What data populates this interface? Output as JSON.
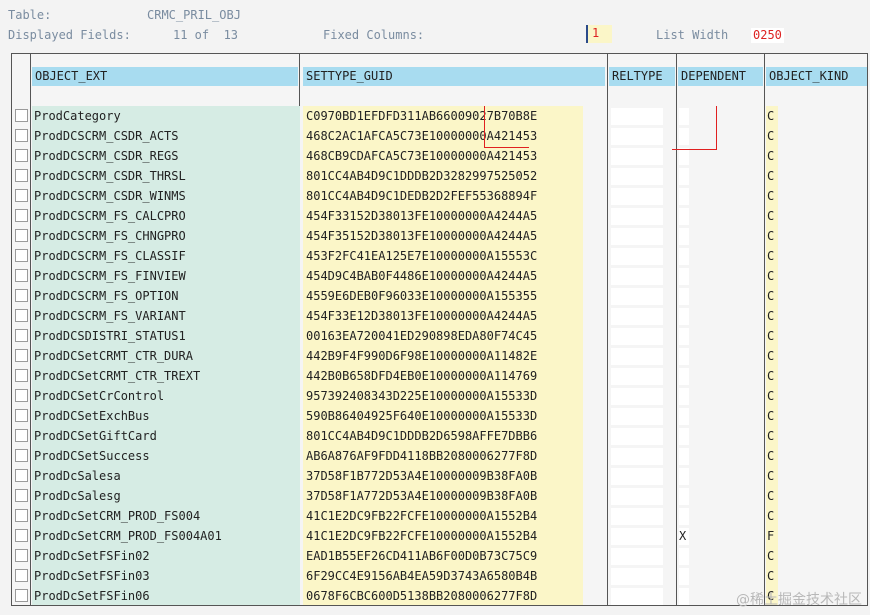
{
  "header": {
    "table_label": "Table:",
    "table_value": "CRMC_PRIL_OBJ",
    "displayed_label": "Displayed Fields:",
    "displayed_value": "11 of  13",
    "fixed_label": "Fixed Columns:",
    "fixed_value": "1",
    "list_width_label": "List Width",
    "list_width_value": "0250"
  },
  "columns": {
    "object_ext": "OBJECT_EXT",
    "settype_guid": "SETTYPE_GUID",
    "reltype": "RELTYPE",
    "dependent": "DEPENDENT",
    "object_kind": "OBJECT_KIND"
  },
  "rows": [
    {
      "ext": "ProdCategory",
      "guid": "C0970BD1EFDFD311AB66009027B70B8E",
      "dep": "",
      "kind": "C"
    },
    {
      "ext": "ProdDCSCRM_CSDR_ACTS",
      "guid": "468C2AC1AFCA5C73E10000000A421453",
      "dep": "",
      "kind": "C"
    },
    {
      "ext": "ProdDCSCRM_CSDR_REGS",
      "guid": "468CB9CDAFCA5C73E10000000A421453",
      "dep": "",
      "kind": "C"
    },
    {
      "ext": "ProdDCSCRM_CSDR_THRSL",
      "guid": "801CC4AB4D9C1DDDB2D3282997525052",
      "dep": "",
      "kind": "C"
    },
    {
      "ext": "ProdDCSCRM_CSDR_WINMS",
      "guid": "801CC4AB4D9C1DEDB2D2FEF55368894F",
      "dep": "",
      "kind": "C"
    },
    {
      "ext": "ProdDCSCRM_FS_CALCPRO",
      "guid": "454F33152D38013FE10000000A4244A5",
      "dep": "",
      "kind": "C"
    },
    {
      "ext": "ProdDCSCRM_FS_CHNGPRO",
      "guid": "454F35152D38013FE10000000A4244A5",
      "dep": "",
      "kind": "C"
    },
    {
      "ext": "ProdDCSCRM_FS_CLASSIF",
      "guid": "453F2FC41EA125E7E10000000A15553C",
      "dep": "",
      "kind": "C"
    },
    {
      "ext": "ProdDCSCRM_FS_FINVIEW",
      "guid": "454D9C4BAB0F4486E10000000A4244A5",
      "dep": "",
      "kind": "C"
    },
    {
      "ext": "ProdDCSCRM_FS_OPTION",
      "guid": "4559E6DEB0F96033E10000000A155355",
      "dep": "",
      "kind": "C"
    },
    {
      "ext": "ProdDCSCRM_FS_VARIANT",
      "guid": "454F33E12D38013FE10000000A4244A5",
      "dep": "",
      "kind": "C"
    },
    {
      "ext": "ProdDCSDISTRI_STATUS1",
      "guid": "00163EA720041ED290898EDA80F74C45",
      "dep": "",
      "kind": "C"
    },
    {
      "ext": "ProdDCSetCRMT_CTR_DURA",
      "guid": "442B9F4F990D6F98E10000000A11482E",
      "dep": "",
      "kind": "C"
    },
    {
      "ext": "ProdDCSetCRMT_CTR_TREXT",
      "guid": "442B0B658DFD4EB0E10000000A114769",
      "dep": "",
      "kind": "C"
    },
    {
      "ext": "ProdDCSetCrControl",
      "guid": "957392408343D225E10000000A15533D",
      "dep": "",
      "kind": "C"
    },
    {
      "ext": "ProdDCSetExchBus",
      "guid": "590B86404925F640E10000000A15533D",
      "dep": "",
      "kind": "C"
    },
    {
      "ext": "ProdDCSetGiftCard",
      "guid": "801CC4AB4D9C1DDDB2D6598AFFE7DBB6",
      "dep": "",
      "kind": "C"
    },
    {
      "ext": "ProdDCSetSuccess",
      "guid": "AB6A876AF9FDD4118BB2080006277F8D",
      "dep": "",
      "kind": "C"
    },
    {
      "ext": "ProdDcSalesa",
      "guid": "37D58F1B772D53A4E10000009B38FA0B",
      "dep": "",
      "kind": "C"
    },
    {
      "ext": "ProdDcSalesg",
      "guid": "37D58F1A772D53A4E10000009B38FA0B",
      "dep": "",
      "kind": "C"
    },
    {
      "ext": "ProdDcSetCRM_PROD_FS004",
      "guid": "41C1E2DC9FB22FCFE10000000A1552B4",
      "dep": "",
      "kind": "C"
    },
    {
      "ext": "ProdDcSetCRM_PROD_FS004A01",
      "guid": "41C1E2DC9FB22FCFE10000000A1552B4",
      "dep": "X",
      "kind": "F"
    },
    {
      "ext": "ProdDcSetFSFin02",
      "guid": "EAD1B55EF26CD411AB6F00D0B73C75C9",
      "dep": "",
      "kind": "C"
    },
    {
      "ext": "ProdDcSetFSFin03",
      "guid": "6F29CC4E9156AB4EA59D3743A6580B4B",
      "dep": "",
      "kind": "C"
    },
    {
      "ext": "ProdDcSetFSFin06",
      "guid": "0678F6CBC600D5138BB2080006277F8D",
      "dep": "",
      "kind": "C"
    }
  ],
  "watermark": "@稀土掘金技术社区",
  "colors": {
    "header_blue": "#a8dcf0",
    "ext_green": "#d6ece4",
    "guid_yellow": "#fbf6c8",
    "annotation_red": "#e02020"
  }
}
